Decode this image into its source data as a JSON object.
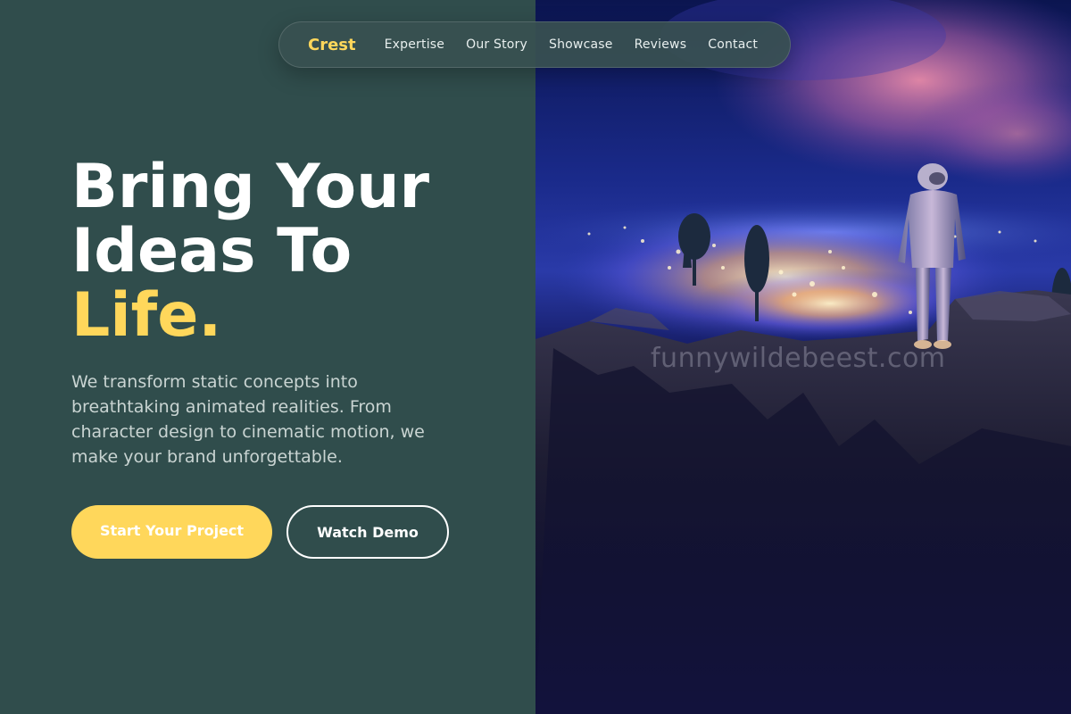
{
  "nav": {
    "brand": "Crest",
    "links": [
      "Expertise",
      "Our Story",
      "Showcase",
      "Reviews",
      "Contact"
    ]
  },
  "hero": {
    "title_line1": "Bring Your",
    "title_line2": "Ideas To",
    "title_accent": "Life.",
    "description": "We transform static concepts into breathtaking animated realities. From character design to cinematic motion, we make your brand unforgettable.",
    "primary_button": "Start Your Project",
    "secondary_button": "Watch Demo"
  },
  "image": {
    "watermark": "funnywildebeest.com",
    "alt_subject": "astronaut-on-cliff-over-city-lights"
  },
  "colors": {
    "background": "#304d4c",
    "accent": "#ffd75b",
    "text_primary": "#ffffff",
    "text_secondary": "#c9d4d2"
  }
}
